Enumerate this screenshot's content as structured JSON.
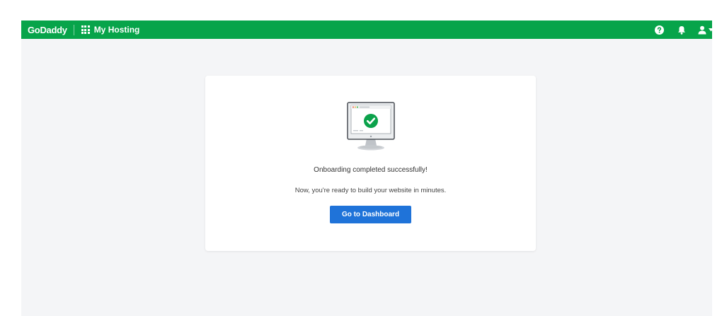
{
  "header": {
    "brand": "GoDaddy",
    "app_title": "My Hosting",
    "icons": [
      "apps-grid-icon",
      "help-icon",
      "bell-icon",
      "user-icon",
      "chevron-down-icon"
    ]
  },
  "card": {
    "illustration": "monitor-checkmark-icon",
    "title": "Onboarding completed successfully!",
    "subtitle": "Now, you're ready to build your website in minutes.",
    "cta_label": "Go to Dashboard"
  },
  "colors": {
    "brand_green": "#07a44a",
    "primary_button": "#1f73d9",
    "page_background": "#f4f5f7",
    "card_background": "#ffffff"
  }
}
